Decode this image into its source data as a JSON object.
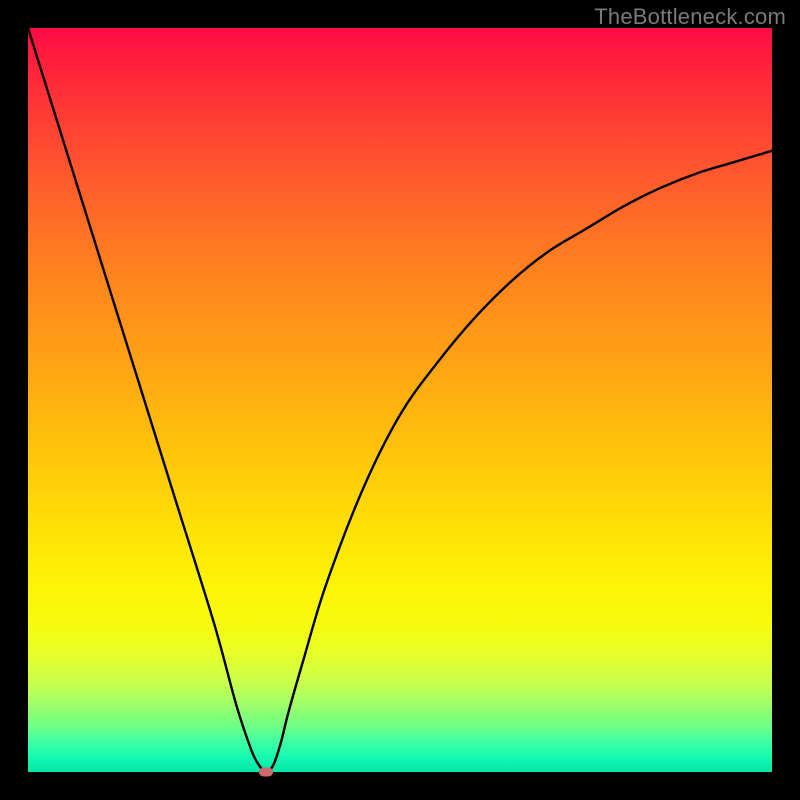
{
  "watermark": "TheBottleneck.com",
  "colors": {
    "frame": "#000000",
    "curve_stroke": "#000000",
    "marker_fill": "#cc6a6d",
    "watermark": "#7a7a7a"
  },
  "chart_data": {
    "type": "line",
    "title": "",
    "xlabel": "",
    "ylabel": "",
    "xlim": [
      0,
      100
    ],
    "ylim": [
      0,
      100
    ],
    "grid": false,
    "legend": false,
    "series": [
      {
        "name": "bottleneck-curve",
        "x": [
          0,
          5,
          10,
          15,
          20,
          25,
          28,
          30,
          31,
          32,
          33,
          34,
          35,
          37,
          40,
          45,
          50,
          55,
          60,
          65,
          70,
          75,
          80,
          85,
          90,
          95,
          100
        ],
        "y": [
          100,
          84,
          68,
          52,
          36,
          20,
          9,
          3,
          1,
          0,
          1,
          4,
          8,
          15,
          25,
          38,
          48,
          55,
          61,
          66,
          70,
          73,
          76,
          78.5,
          80.5,
          82,
          83.5
        ]
      }
    ],
    "marker": {
      "x": 32,
      "y": 0
    },
    "background_gradient": {
      "orientation": "vertical",
      "stops": [
        {
          "pos": 0.0,
          "color": "#ff0b48"
        },
        {
          "pos": 0.3,
          "color": "#ff7a21"
        },
        {
          "pos": 0.55,
          "color": "#ffbf0c"
        },
        {
          "pos": 0.78,
          "color": "#f9fb0a"
        },
        {
          "pos": 0.9,
          "color": "#9dff6a"
        },
        {
          "pos": 1.0,
          "color": "#02e7a9"
        }
      ]
    }
  }
}
